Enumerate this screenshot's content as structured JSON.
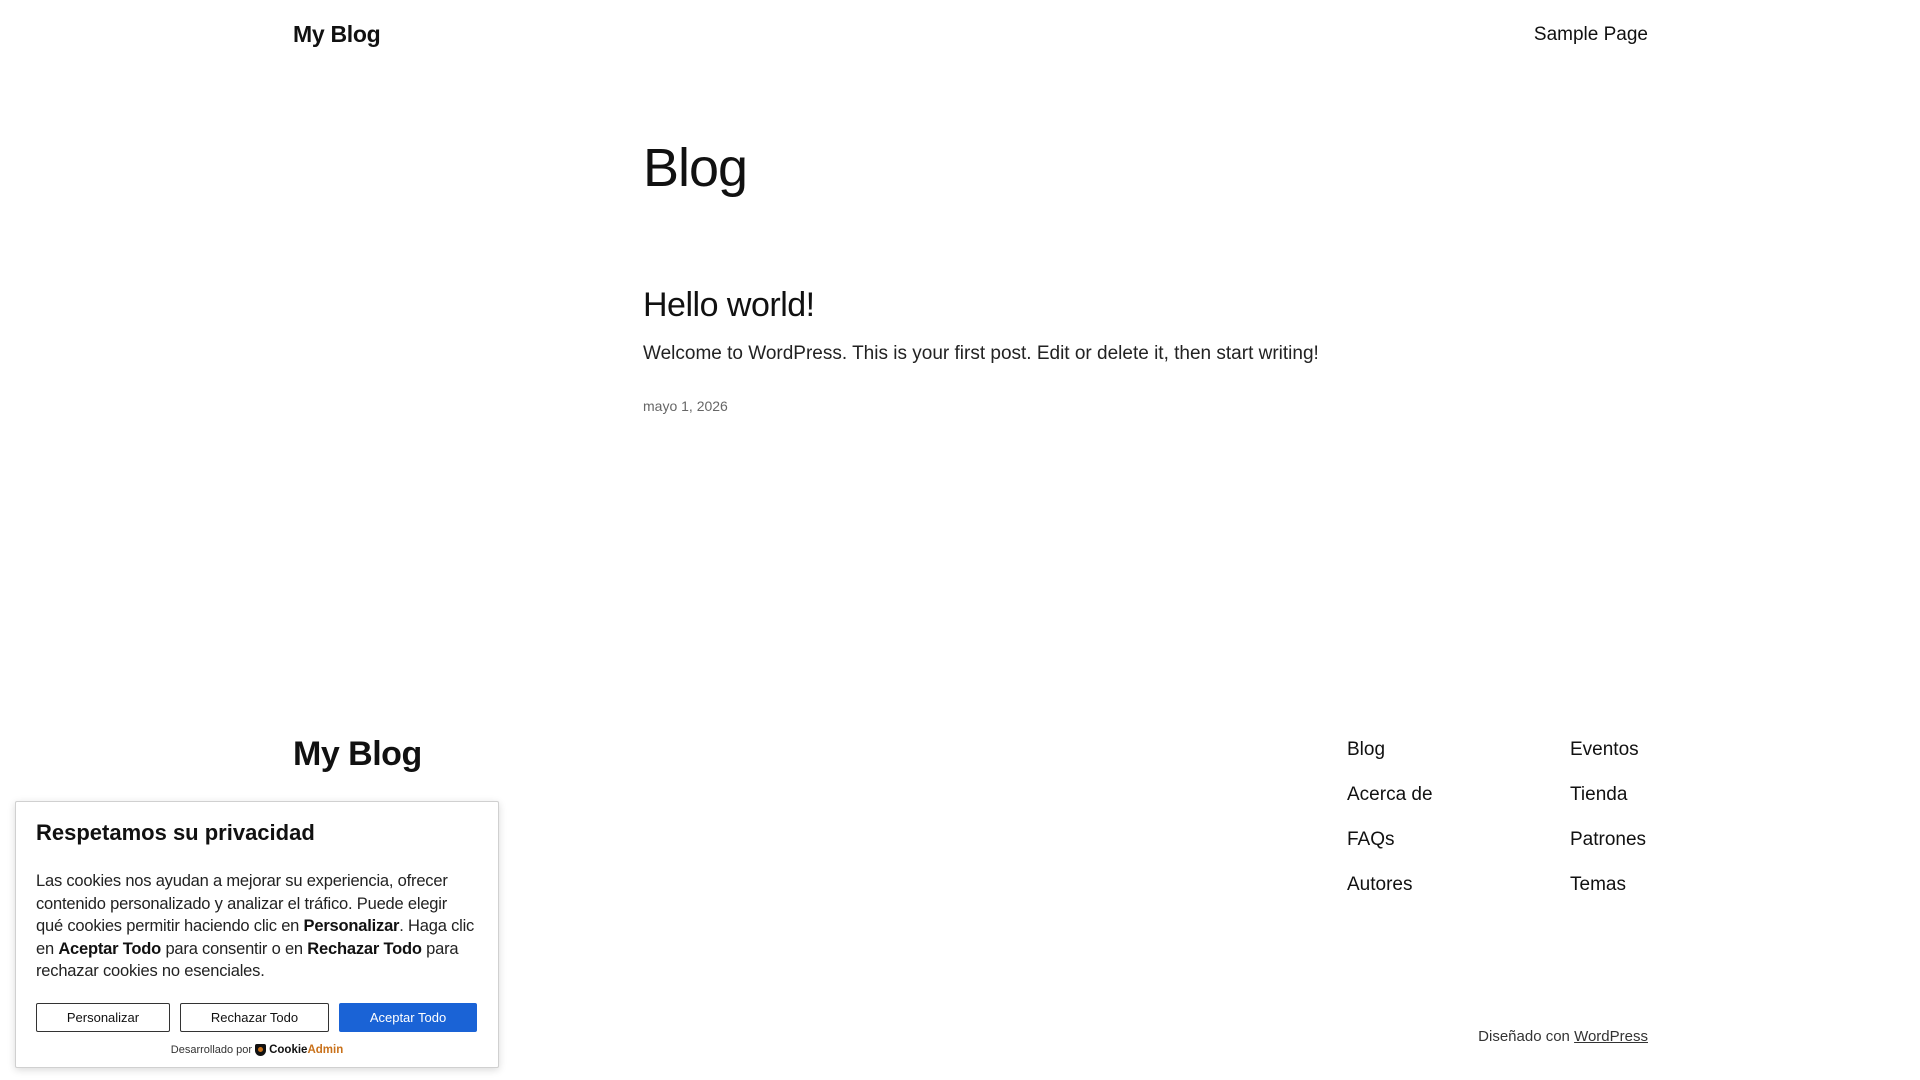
{
  "header": {
    "site_title": "My Blog",
    "nav": [
      "Sample Page"
    ]
  },
  "main": {
    "page_title": "Blog",
    "posts": [
      {
        "title": "Hello world!",
        "excerpt": "Welcome to WordPress. This is your first post. Edit or delete it, then start writing!",
        "date": "mayo 1, 2026"
      }
    ]
  },
  "footer": {
    "site_title": "My Blog",
    "col1": [
      "Blog",
      "Acerca de",
      "FAQs",
      "Autores"
    ],
    "col2": [
      "Eventos",
      "Tienda",
      "Patrones",
      "Temas"
    ],
    "credit_prefix": "Diseñado con",
    "credit_link": "WordPress"
  },
  "cookie": {
    "title": "Respetamos su privacidad",
    "text_1": "Las cookies nos ayudan a mejorar su experiencia, ofrecer contenido personalizado y analizar el tráfico. Puede elegir qué cookies permitir haciendo clic en ",
    "bold_1": "Personalizar",
    "text_2": ". Haga clic en ",
    "bold_2": "Aceptar Todo",
    "text_3": " para consentir o en ",
    "bold_3": "Rechazar Todo",
    "text_4": " para rechazar cookies no esenciales.",
    "buttons": {
      "customize": "Personalizar",
      "reject": "Rechazar Todo",
      "accept": "Aceptar Todo"
    },
    "powered_by": "Desarrollado por",
    "brand_1": "Cookie",
    "brand_2": "Admin",
    "accent_color": "#1a63d6"
  }
}
